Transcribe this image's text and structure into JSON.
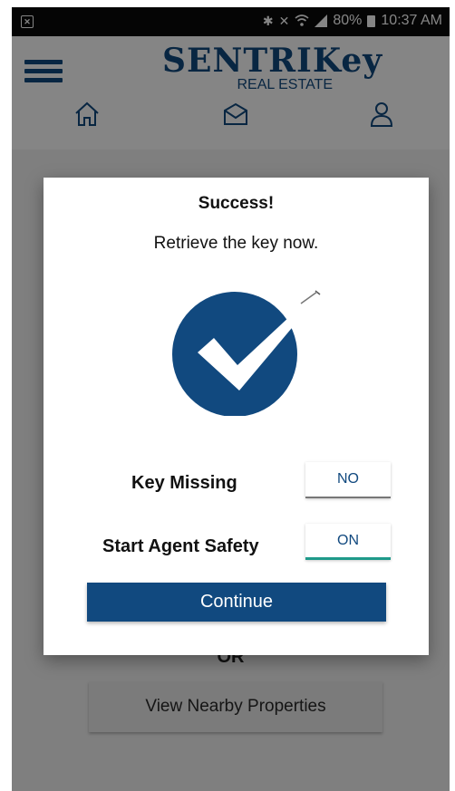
{
  "status_bar": {
    "battery": "80%",
    "time": "10:37 AM",
    "icons": [
      "bluetooth-icon",
      "mute-icon",
      "wifi-icon",
      "signal-icon",
      "battery-icon"
    ]
  },
  "header": {
    "logo_main": "SENTRIKey",
    "logo_sub": "REAL ESTATE",
    "nav_icons": [
      "home-icon",
      "mail-icon",
      "user-icon"
    ]
  },
  "background": {
    "or_text": "OR",
    "nearby_button": "View Nearby Properties"
  },
  "dialog": {
    "title": "Success!",
    "message": "Retrieve the key now.",
    "key_missing_label": "Key Missing",
    "key_missing_value": "NO",
    "agent_safety_label": "Start Agent Safety",
    "agent_safety_value": "ON",
    "continue_label": "Continue"
  },
  "colors": {
    "brand": "#11497f",
    "toggle_on_accent": "#1e9a8a"
  }
}
